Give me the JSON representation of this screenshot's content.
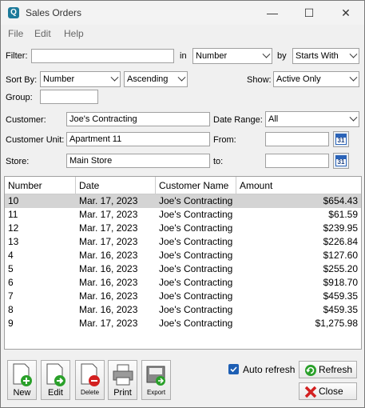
{
  "window": {
    "title": "Sales Orders",
    "minimize": "—",
    "maximize": "☐",
    "close": "✕"
  },
  "menu": {
    "file": "File",
    "edit": "Edit",
    "help": "Help"
  },
  "filter": {
    "label": "Filter:",
    "value": "",
    "in_label": "in",
    "in_value": "Number",
    "by_label": "by",
    "by_value": "Starts With"
  },
  "sort": {
    "label": "Sort By:",
    "field": "Number",
    "order": "Ascending",
    "show_label": "Show:",
    "show_value": "Active Only"
  },
  "group": {
    "label": "Group:",
    "value": ""
  },
  "customer": {
    "label": "Customer:",
    "value": "Joe's Contracting"
  },
  "customer_unit": {
    "label": "Customer Unit:",
    "value": "Apartment 11"
  },
  "store": {
    "label": "Store:",
    "value": "Main Store"
  },
  "date_range": {
    "label": "Date Range:",
    "value": "All",
    "from_label": "From:",
    "from_value": "",
    "to_label": "to:",
    "to_value": "",
    "cal_day": "31"
  },
  "table": {
    "headers": [
      "Number",
      "Date",
      "Customer Name",
      "Amount"
    ],
    "rows": [
      {
        "number": "10",
        "date": "Mar. 17, 2023",
        "customer": "Joe's Contracting",
        "amount": "$654.43"
      },
      {
        "number": "11",
        "date": "Mar. 17, 2023",
        "customer": "Joe's Contracting",
        "amount": "$61.59"
      },
      {
        "number": "12",
        "date": "Mar. 17, 2023",
        "customer": "Joe's Contracting",
        "amount": "$239.95"
      },
      {
        "number": "13",
        "date": "Mar. 17, 2023",
        "customer": "Joe's Contracting",
        "amount": "$226.84"
      },
      {
        "number": "4",
        "date": "Mar. 16, 2023",
        "customer": "Joe's Contracting",
        "amount": "$127.60"
      },
      {
        "number": "5",
        "date": "Mar. 16, 2023",
        "customer": "Joe's Contracting",
        "amount": "$255.20"
      },
      {
        "number": "6",
        "date": "Mar. 16, 2023",
        "customer": "Joe's Contracting",
        "amount": "$918.70"
      },
      {
        "number": "7",
        "date": "Mar. 16, 2023",
        "customer": "Joe's Contracting",
        "amount": "$459.35"
      },
      {
        "number": "8",
        "date": "Mar. 16, 2023",
        "customer": "Joe's Contracting",
        "amount": "$459.35"
      },
      {
        "number": "9",
        "date": "Mar. 17, 2023",
        "customer": "Joe's Contracting",
        "amount": "$1,275.98"
      }
    ]
  },
  "toolbar": {
    "new": "New",
    "edit": "Edit",
    "delete": "Delete",
    "print": "Print",
    "export": "Export"
  },
  "auto_refresh": {
    "label": "Auto refresh",
    "checked": true
  },
  "buttons": {
    "refresh": "Refresh",
    "close": "Close"
  },
  "colors": {
    "accent": "#1e5fb4",
    "selected_row": "#d4d4d4",
    "delete": "#d32020",
    "add": "#2aa02a"
  }
}
